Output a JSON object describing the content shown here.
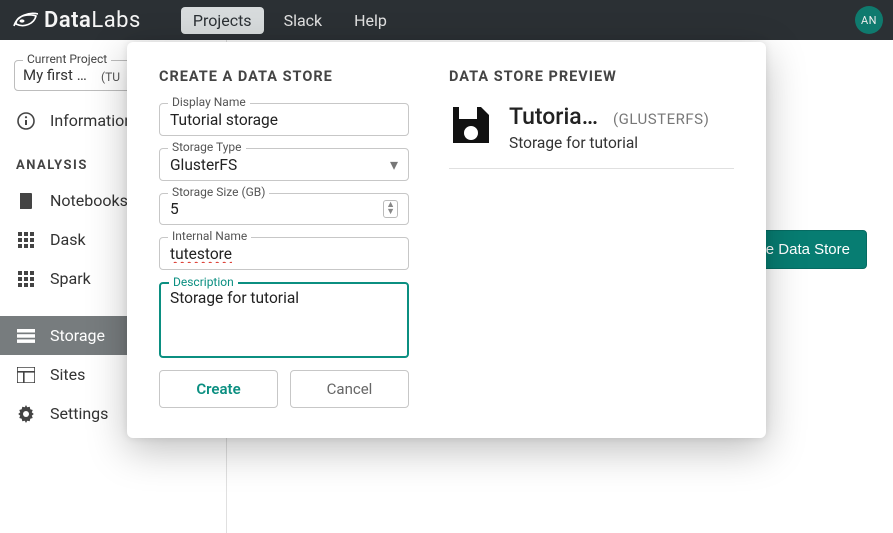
{
  "brand": {
    "bold": "Data",
    "thin": "Labs"
  },
  "topnav": {
    "projects": "Projects",
    "slack": "Slack",
    "help": "Help"
  },
  "avatar": "AN",
  "sidebar": {
    "current_project_label": "Current Project",
    "current_project_value": "My first project",
    "current_project_suffix": "(TU",
    "information": "Information",
    "section_analysis": "ANALYSIS",
    "notebooks": "Notebooks",
    "dask": "Dask",
    "spark": "Spark",
    "storage": "Storage",
    "sites": "Sites",
    "settings": "Settings"
  },
  "content": {
    "create_button": "+ Create Data Store"
  },
  "modal": {
    "title": "CREATE A DATA STORE",
    "preview_title": "DATA STORE PREVIEW",
    "fields": {
      "display_name_label": "Display Name",
      "display_name_value": "Tutorial storage",
      "storage_type_label": "Storage Type",
      "storage_type_value": "GlusterFS",
      "storage_size_label": "Storage Size (GB)",
      "storage_size_value": "5",
      "internal_name_label": "Internal Name",
      "internal_name_value": "tutestore",
      "description_label": "Description",
      "description_value": "Storage for tutorial"
    },
    "buttons": {
      "create": "Create",
      "cancel": "Cancel"
    },
    "preview": {
      "title": "Tutorial storage",
      "type": "(GLUSTERFS)",
      "desc": "Storage for tutorial"
    }
  }
}
